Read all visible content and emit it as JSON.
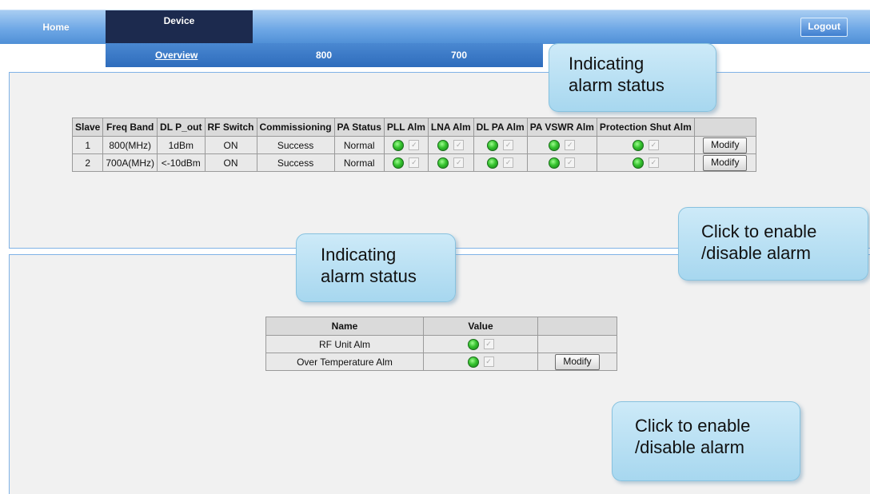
{
  "nav": {
    "tabs": [
      {
        "label": "Home"
      },
      {
        "label": "Device"
      }
    ],
    "logout_label": "Logout",
    "subtabs": [
      {
        "label": "Overview"
      },
      {
        "label": "800"
      },
      {
        "label": "700"
      }
    ]
  },
  "slave_table": {
    "headers": [
      "Slave",
      "Freq Band",
      "DL P_out",
      "RF Switch",
      "Commissioning",
      "PA Status",
      "PLL Alm",
      "LNA Alm",
      "DL PA Alm",
      "PA VSWR Alm",
      "Protection Shut Alm",
      ""
    ],
    "rows": [
      {
        "slave": "1",
        "freq_band": "800(MHz)",
        "dl_pout": "1dBm",
        "rf_switch": "ON",
        "commissioning": "Success",
        "pa_status": "Normal",
        "button": "Modify"
      },
      {
        "slave": "2",
        "freq_band": "700A(MHz)",
        "dl_pout": "<-10dBm",
        "rf_switch": "ON",
        "commissioning": "Success",
        "pa_status": "Normal",
        "button": "Modify"
      }
    ]
  },
  "alarm_table": {
    "headers": [
      "Name",
      "Value",
      ""
    ],
    "rows": [
      {
        "name": "RF Unit Alm",
        "button": ""
      },
      {
        "name": "Over Temperature Alm",
        "button": "Modify"
      }
    ]
  },
  "callouts": {
    "alarm_status_top": {
      "line1": "Indicating",
      "line2": "alarm status"
    },
    "enable_top": {
      "line1": "Click to enable",
      "line2": "/disable alarm"
    },
    "alarm_status_bottom": {
      "line1": "Indicating",
      "line2": "alarm status"
    },
    "enable_bottom": {
      "line1": "Click to enable",
      "line2": "/disable alarm"
    }
  },
  "colors": {
    "nav_active": "#1c2a4e",
    "nav_bar": "#6fa8e6",
    "led_green": "#35c22e",
    "callout_fill": "#b7def2"
  }
}
